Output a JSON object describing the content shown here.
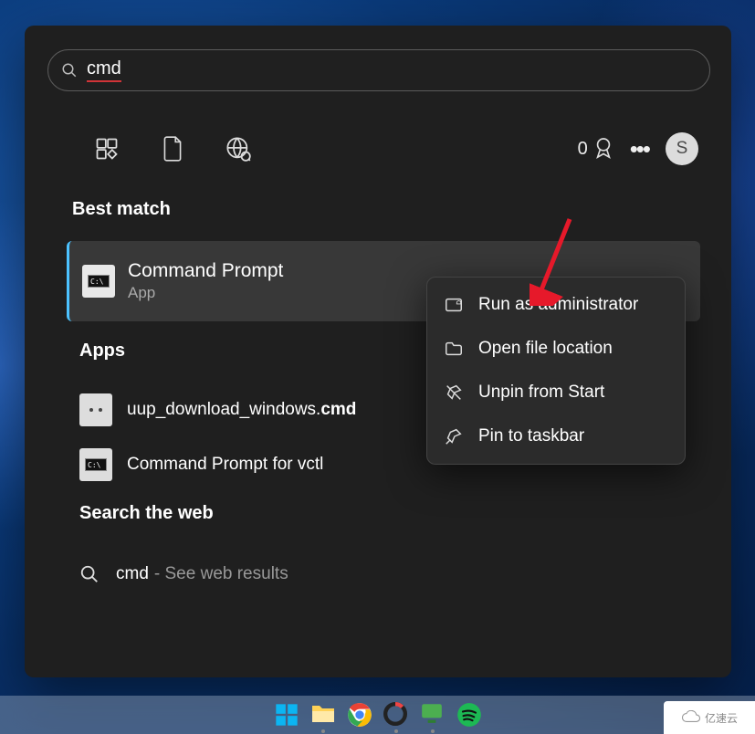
{
  "search": {
    "query": "cmd"
  },
  "rewards": {
    "points": "0",
    "avatar_letter": "S"
  },
  "sections": {
    "best_match": "Best match",
    "apps": "Apps",
    "web": "Search the web"
  },
  "best_match": {
    "title": "Command Prompt",
    "subtitle": "App"
  },
  "apps": [
    {
      "prefix": "uup_download_windows.",
      "bold": "cmd"
    },
    {
      "full": "Command Prompt for vctl"
    }
  ],
  "web": {
    "term": "cmd",
    "suffix": " - See web results"
  },
  "context_menu": [
    {
      "label": "Run as administrator",
      "icon": "admin"
    },
    {
      "label": "Open file location",
      "icon": "folder"
    },
    {
      "label": "Unpin from Start",
      "icon": "unpin"
    },
    {
      "label": "Pin to taskbar",
      "icon": "pin"
    }
  ],
  "watermark": "亿速云"
}
